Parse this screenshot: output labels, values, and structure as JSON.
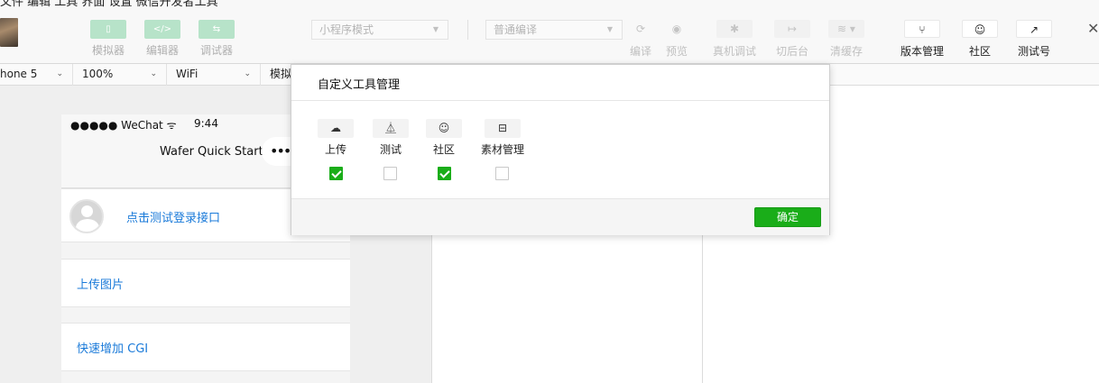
{
  "window": {
    "title_fragment": "文件 编辑 工具 界面 设置 微信开发者工具",
    "close_glyph": "✕"
  },
  "toolbar": {
    "simulator_label": "模拟器",
    "editor_label": "编辑器",
    "debugger_label": "调试器",
    "mode_select": "小程序模式",
    "compile_select": "普通编译",
    "compile_label": "编译",
    "preview_label": "预览",
    "remote_debug_label": "真机调试",
    "background_label": "切后台",
    "clear_cache_label": "清缓存",
    "version_label": "版本管理",
    "community_label": "社区",
    "test_account_label": "测试号"
  },
  "device_bar": {
    "device": "hone 5",
    "zoom": "100%",
    "network": "WiFi",
    "more": "模拟"
  },
  "simulator": {
    "carrier": "●●●●● WeChat",
    "time": "9:44",
    "nav_title": "Wafer Quick Start",
    "capsule": "•••",
    "rows": [
      {
        "label": "点击测试登录接口"
      },
      {
        "label": "上传图片"
      },
      {
        "label": "快速增加 CGI"
      }
    ]
  },
  "dialog": {
    "title": "自定义工具管理",
    "tools": [
      {
        "label": "上传",
        "icon": "cloud-upload-icon",
        "checked": true
      },
      {
        "label": "测试",
        "icon": "flask-icon",
        "checked": false
      },
      {
        "label": "社区",
        "icon": "chat-bubble-icon",
        "checked": true
      },
      {
        "label": "素材管理",
        "icon": "material-box-icon",
        "checked": false
      }
    ],
    "confirm_label": "确定"
  },
  "colors": {
    "accent_green": "#1aad19",
    "link_blue": "#1a7ad9",
    "disabled_green": "#b7e3c9"
  }
}
